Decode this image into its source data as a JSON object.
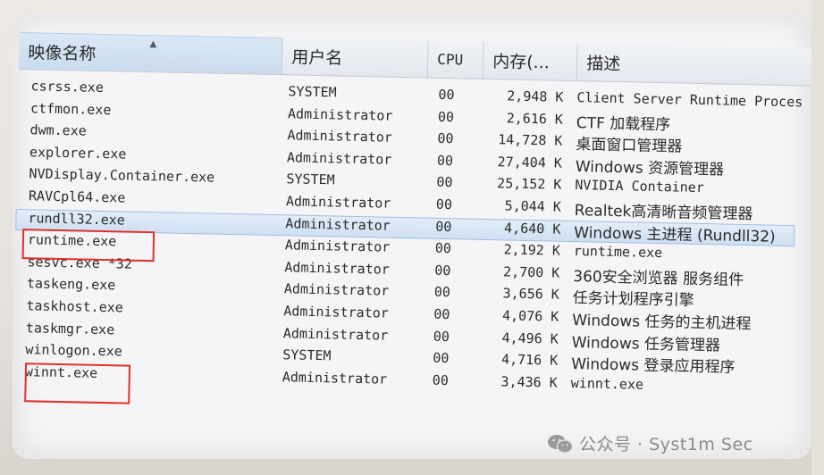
{
  "columns": {
    "image_name": "映像名称",
    "user_name": "用户名",
    "cpu": "CPU",
    "memory": "内存(...",
    "description": "描述"
  },
  "processes": [
    {
      "name": "csrss.exe",
      "user": "SYSTEM",
      "cpu": "00",
      "mem": "2,948 K",
      "desc": "Client Server Runtime Proces"
    },
    {
      "name": "ctfmon.exe",
      "user": "Administrator",
      "cpu": "00",
      "mem": "2,616 K",
      "desc": "CTF 加载程序"
    },
    {
      "name": "dwm.exe",
      "user": "Administrator",
      "cpu": "00",
      "mem": "14,728 K",
      "desc": "桌面窗口管理器"
    },
    {
      "name": "explorer.exe",
      "user": "Administrator",
      "cpu": "00",
      "mem": "27,404 K",
      "desc": "Windows 资源管理器"
    },
    {
      "name": "NVDisplay.Container.exe",
      "user": "SYSTEM",
      "cpu": "00",
      "mem": "25,152 K",
      "desc": "NVIDIA Container"
    },
    {
      "name": "RAVCpl64.exe",
      "user": "Administrator",
      "cpu": "00",
      "mem": "5,044 K",
      "desc": "Realtek高清晰音频管理器"
    },
    {
      "name": "rundll32.exe",
      "user": "Administrator",
      "cpu": "00",
      "mem": "4,640 K",
      "desc": "Windows 主进程 (Rundll32)"
    },
    {
      "name": "runtime.exe",
      "user": "Administrator",
      "cpu": "00",
      "mem": "2,192 K",
      "desc": "runtime.exe"
    },
    {
      "name": "sesvc.exe *32",
      "user": "Administrator",
      "cpu": "00",
      "mem": "2,700 K",
      "desc": "360安全浏览器 服务组件"
    },
    {
      "name": "taskeng.exe",
      "user": "Administrator",
      "cpu": "00",
      "mem": "3,656 K",
      "desc": "任务计划程序引擎"
    },
    {
      "name": "taskhost.exe",
      "user": "Administrator",
      "cpu": "00",
      "mem": "4,076 K",
      "desc": "Windows 任务的主机进程"
    },
    {
      "name": "taskmgr.exe",
      "user": "Administrator",
      "cpu": "00",
      "mem": "4,496 K",
      "desc": "Windows 任务管理器"
    },
    {
      "name": "winlogon.exe",
      "user": "SYSTEM",
      "cpu": "00",
      "mem": "4,716 K",
      "desc": "Windows 登录应用程序"
    },
    {
      "name": "winnt.exe",
      "user": "Administrator",
      "cpu": "00",
      "mem": "3,436 K",
      "desc": "winnt.exe"
    }
  ],
  "selected_process": "rundll32.exe",
  "highlighted_processes": [
    "runtime.exe",
    "winnt.exe"
  ],
  "highlight_color": "#e0302c",
  "selection_color": "#cfe0f2",
  "watermark": {
    "icon": "wechat-icon",
    "text": "公众号 · Syst1m Sec"
  }
}
